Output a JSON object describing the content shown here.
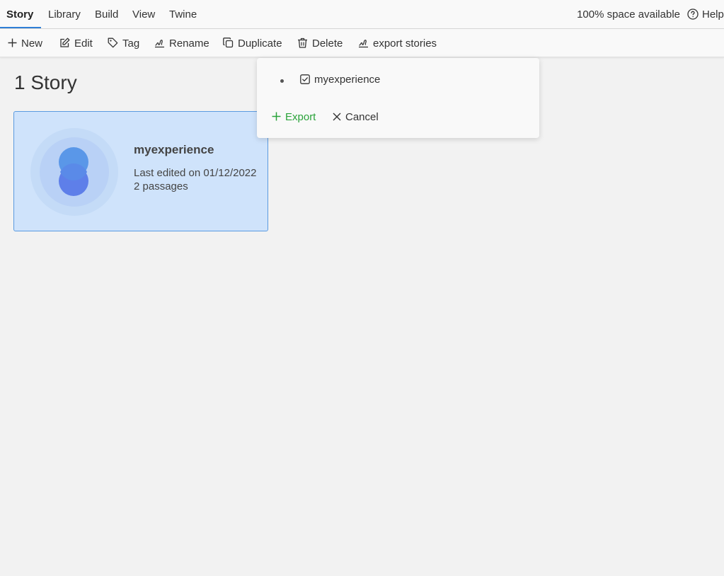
{
  "tabs": [
    {
      "label": "Story",
      "active": true
    },
    {
      "label": "Library",
      "active": false
    },
    {
      "label": "Build",
      "active": false
    },
    {
      "label": "View",
      "active": false
    },
    {
      "label": "Twine",
      "active": false
    }
  ],
  "status": {
    "space": "100% space available",
    "help": "Help"
  },
  "toolbar": {
    "new": "New",
    "edit": "Edit",
    "tag": "Tag",
    "rename": "Rename",
    "duplicate": "Duplicate",
    "delete": "Delete",
    "export": "export stories"
  },
  "main": {
    "heading": "1 Story"
  },
  "story_card": {
    "title": "myexperience",
    "last_edited": "Last edited on 01/12/2022",
    "passages": "2 passages",
    "selected": true
  },
  "export_popover": {
    "item_label": "myexperience",
    "item_checked": true,
    "export_label": "Export",
    "cancel_label": "Cancel"
  },
  "colors": {
    "accent": "#2f7fd6",
    "card_bg": "#cfe3fb",
    "card_border": "#5b9be0",
    "export_green": "#2aa33a"
  }
}
